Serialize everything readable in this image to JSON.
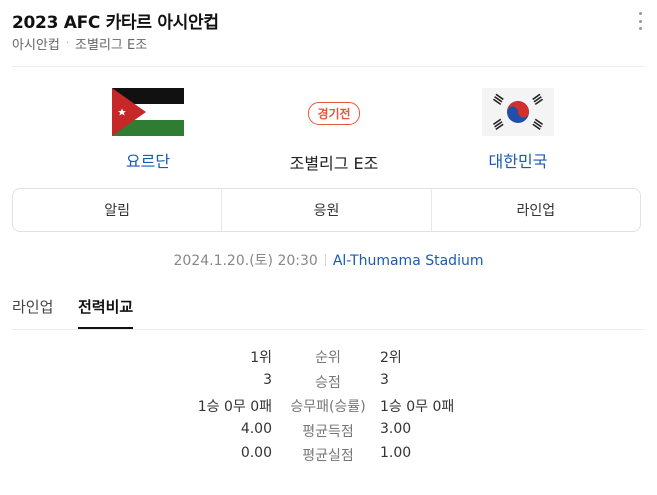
{
  "header": {
    "title": "2023 AFC 카타르 아시안컵",
    "breadcrumb": [
      "아시안컵",
      "조별리그 E조"
    ]
  },
  "match": {
    "home_team": "요르단",
    "away_team": "대한민국",
    "status_badge": "경기전",
    "stage": "조별리그 E조"
  },
  "tabs": [
    "알림",
    "응원",
    "라인업"
  ],
  "info": {
    "datetime": "2024.1.20.(토) 20:30",
    "venue": "Al-Thumama Stadium"
  },
  "subtabs": [
    "라인업",
    "전력비교"
  ],
  "stats": [
    {
      "label": "순위",
      "home": "1위",
      "away": "2위"
    },
    {
      "label": "승점",
      "home": "3",
      "away": "3"
    },
    {
      "label": "승무패(승률)",
      "home": "1승 0무 0패",
      "away": "1승 0무 0패"
    },
    {
      "label": "평균득점",
      "home": "4.00",
      "away": "3.00"
    },
    {
      "label": "평균실점",
      "home": "0.00",
      "away": "1.00"
    }
  ],
  "colors": {
    "link_blue": "#1a5bb4",
    "badge_red": "#e05a3a"
  },
  "icons": {
    "more": "more-vertical-icon",
    "home_flag": "jordan-flag",
    "away_flag": "south-korea-flag"
  }
}
